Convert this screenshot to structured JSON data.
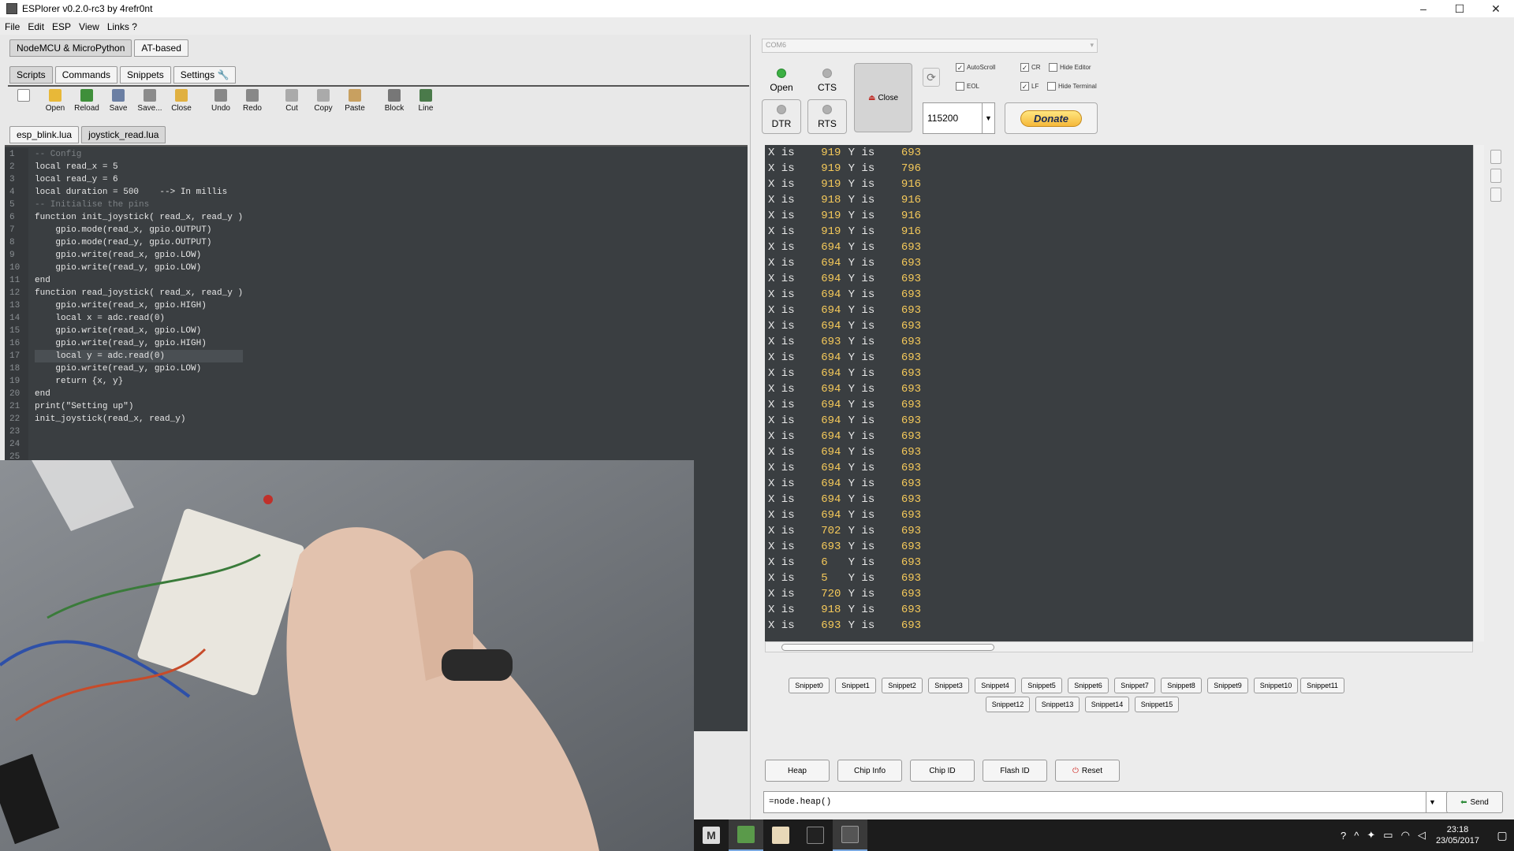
{
  "window": {
    "title": "ESPlorer v0.2.0-rc3 by 4refr0nt"
  },
  "menu": [
    "File",
    "Edit",
    "ESP",
    "View",
    "Links ?"
  ],
  "firmware_tabs": [
    "NodeMCU & MicroPython",
    "AT-based"
  ],
  "section_tabs": [
    "Scripts",
    "Commands",
    "Snippets",
    "Settings"
  ],
  "toolbar": [
    {
      "label": "Open",
      "icon": "folder-open-icon",
      "color": "#e8b838"
    },
    {
      "label": "Reload",
      "icon": "reload-icon",
      "color": "#3f8f3a"
    },
    {
      "label": "Save",
      "icon": "save-icon",
      "color": "#6b7fa3"
    },
    {
      "label": "Save...",
      "icon": "save-as-icon",
      "color": "#8b8b8b"
    },
    {
      "label": "Close",
      "icon": "close-file-icon",
      "color": "#e0b040"
    },
    {
      "label": "Undo",
      "icon": "undo-icon",
      "color": "#888"
    },
    {
      "label": "Redo",
      "icon": "redo-icon",
      "color": "#888"
    },
    {
      "label": "Cut",
      "icon": "cut-icon",
      "color": "#aaa"
    },
    {
      "label": "Copy",
      "icon": "copy-icon",
      "color": "#aaa"
    },
    {
      "label": "Paste",
      "icon": "paste-icon",
      "color": "#c8a060"
    },
    {
      "label": "Block",
      "icon": "block-icon",
      "color": "#777"
    },
    {
      "label": "Line",
      "icon": "line-icon",
      "color": "#4a7a4a"
    }
  ],
  "file_tabs": [
    "esp_blink.lua",
    "joystick_read.lua"
  ],
  "code_lines": [
    "-- Config",
    "local read_x = 5",
    "local read_y = 6",
    "local duration = 500    --> In millis",
    "",
    "-- Initialise the pins",
    "function init_joystick( read_x, read_y )",
    "    gpio.mode(read_x, gpio.OUTPUT)",
    "    gpio.mode(read_y, gpio.OUTPUT)",
    "    gpio.write(read_x, gpio.LOW)",
    "    gpio.write(read_y, gpio.LOW)",
    "end",
    "",
    "function read_joystick( read_x, read_y )",
    "    gpio.write(read_x, gpio.HIGH)",
    "    local x = adc.read(0)",
    "    gpio.write(read_x, gpio.LOW)",
    "    gpio.write(read_y, gpio.HIGH)",
    "    local y = adc.read(0)",
    "    gpio.write(read_y, gpio.LOW)",
    "    return {x, y}",
    "end",
    "",
    "print(\"Setting up\")",
    "init_joystick(read_x, read_y)"
  ],
  "highlighted_line": 19,
  "serial": {
    "port": "COM6",
    "open_label": "Open",
    "cts_label": "CTS",
    "dtr_label": "DTR",
    "rts_label": "RTS",
    "close_label": "Close",
    "baud": "115200",
    "donate_label": "Donate",
    "checkboxes": [
      {
        "label": "AutoScroll",
        "checked": true
      },
      {
        "label": "CR",
        "checked": true
      },
      {
        "label": "Hide Editor",
        "checked": false
      },
      {
        "label": "EOL",
        "checked": false
      },
      {
        "label": "LF",
        "checked": true
      },
      {
        "label": "Hide Terminal",
        "checked": false
      }
    ]
  },
  "terminal": [
    [
      "919",
      "693"
    ],
    [
      "919",
      "796"
    ],
    [
      "919",
      "916"
    ],
    [
      "918",
      "916"
    ],
    [
      "919",
      "916"
    ],
    [
      "919",
      "916"
    ],
    [
      "694",
      "693"
    ],
    [
      "694",
      "693"
    ],
    [
      "694",
      "693"
    ],
    [
      "694",
      "693"
    ],
    [
      "694",
      "693"
    ],
    [
      "694",
      "693"
    ],
    [
      "693",
      "693"
    ],
    [
      "694",
      "693"
    ],
    [
      "694",
      "693"
    ],
    [
      "694",
      "693"
    ],
    [
      "694",
      "693"
    ],
    [
      "694",
      "693"
    ],
    [
      "694",
      "693"
    ],
    [
      "694",
      "693"
    ],
    [
      "694",
      "693"
    ],
    [
      "694",
      "693"
    ],
    [
      "694",
      "693"
    ],
    [
      "694",
      "693"
    ],
    [
      "702",
      "693"
    ],
    [
      "693",
      "693"
    ],
    [
      "6",
      "693"
    ],
    [
      "5",
      "693"
    ],
    [
      "720",
      "693"
    ],
    [
      "918",
      "693"
    ],
    [
      "693",
      "693"
    ]
  ],
  "snippets": [
    "Snippet0",
    "Snippet1",
    "Snippet2",
    "Snippet3",
    "Snippet4",
    "Snippet5",
    "Snippet6",
    "Snippet7",
    "Snippet8",
    "Snippet9",
    "Snippet10",
    "Snippet11",
    "Snippet12",
    "Snippet13",
    "Snippet14",
    "Snippet15"
  ],
  "actions": [
    "Heap",
    "Chip Info",
    "Chip ID",
    "Flash ID",
    "Reset"
  ],
  "command": {
    "value": "=node.heap()",
    "send_label": "Send"
  },
  "clock": {
    "time": "23:18",
    "date": "23/05/2017"
  }
}
